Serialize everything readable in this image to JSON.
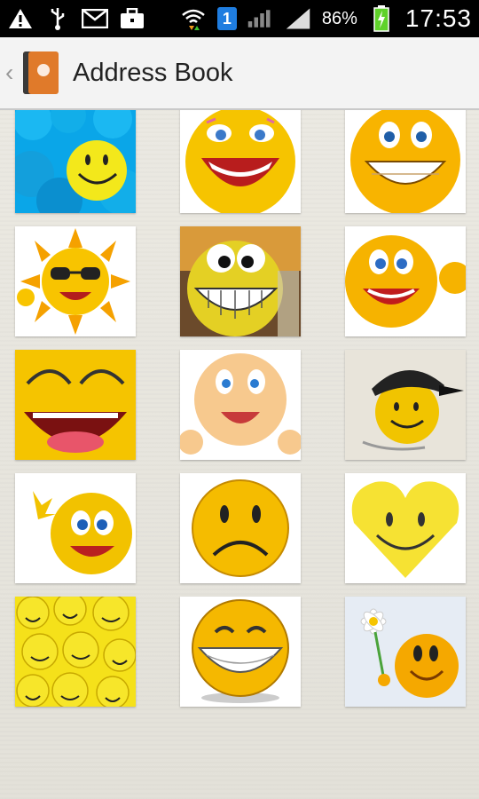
{
  "status_bar": {
    "time": "17:53",
    "battery_percent": "86%",
    "sim_slot": "1",
    "icons": [
      "warning-icon",
      "usb-icon",
      "email-icon",
      "briefcase-icon",
      "wifi-icon",
      "signal-icon",
      "battery-charging-icon"
    ]
  },
  "action_bar": {
    "title": "Address Book",
    "icon": "contacts-book-icon"
  },
  "gallery": {
    "items": [
      {
        "name": "blue-balls-smiley"
      },
      {
        "name": "lipstick-laughing-smiley"
      },
      {
        "name": "grinning-smiley"
      },
      {
        "name": "sun-sunglasses-smiley"
      },
      {
        "name": "big-teeth-smiley"
      },
      {
        "name": "thumbs-up-smiley"
      },
      {
        "name": "laughing-closeup-smiley"
      },
      {
        "name": "peach-face-smiley"
      },
      {
        "name": "cap-smiley"
      },
      {
        "name": "waving-smiley"
      },
      {
        "name": "sad-smiley"
      },
      {
        "name": "heart-smiley"
      },
      {
        "name": "many-smileys"
      },
      {
        "name": "happy-teeth-smiley"
      },
      {
        "name": "flower-smiley"
      }
    ]
  },
  "colors": {
    "accent_yellow": "#f5c400",
    "status_bar": "#000000",
    "action_bar": "#f3f3f3"
  }
}
